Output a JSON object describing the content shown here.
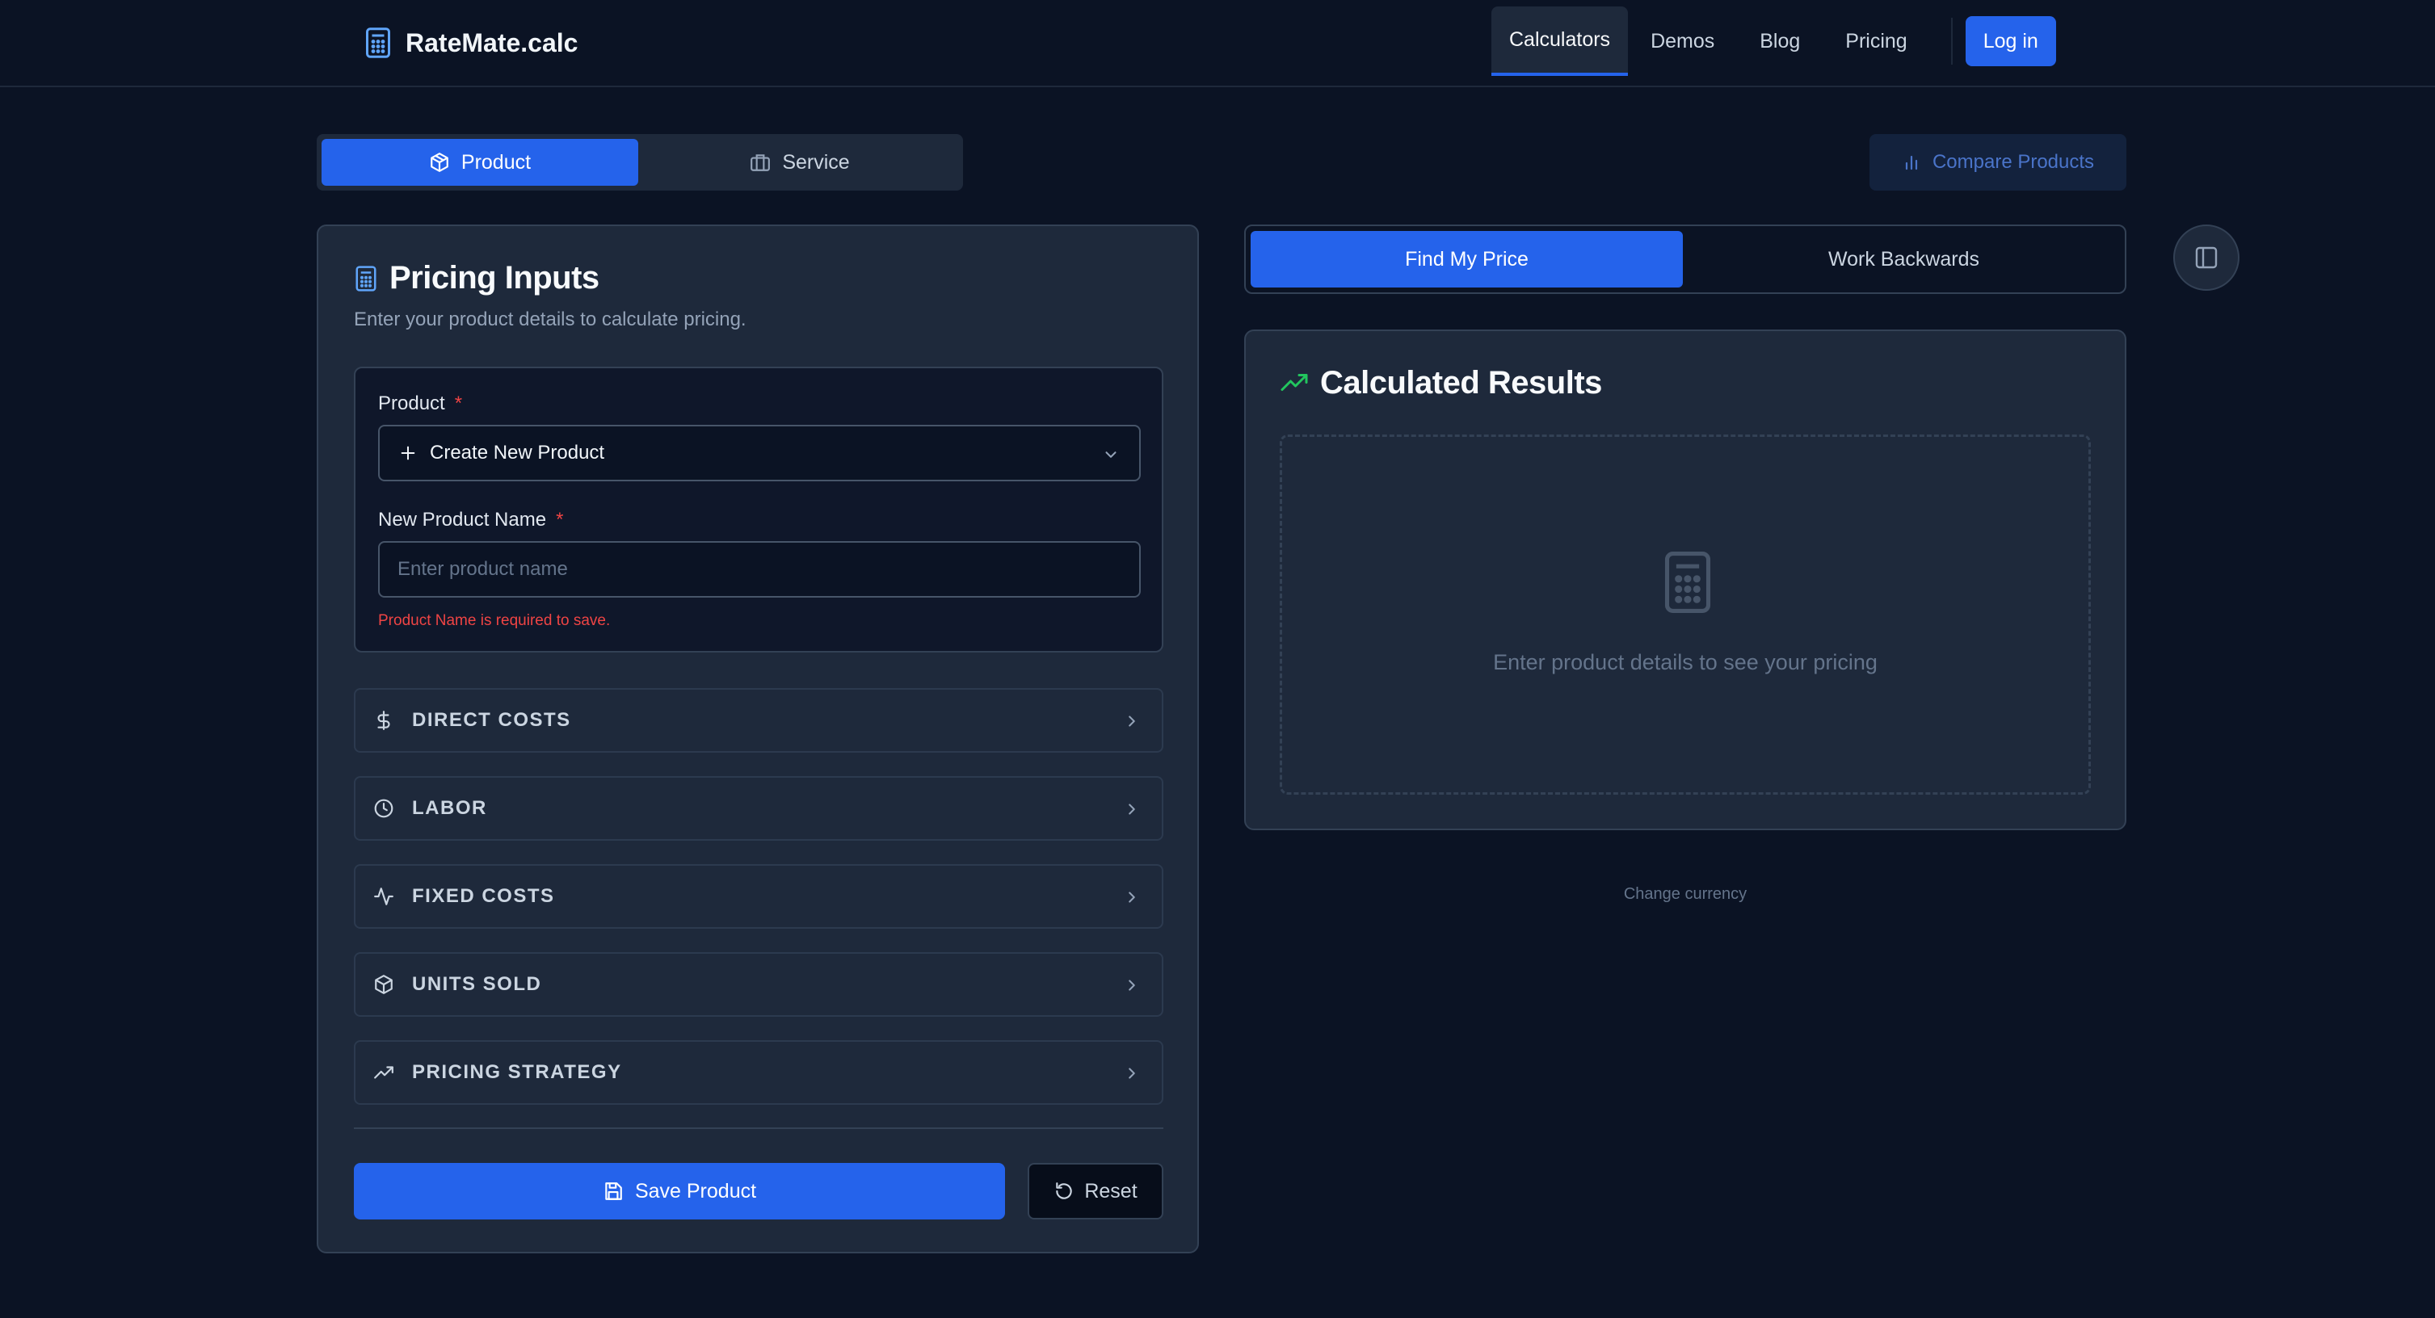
{
  "brand": {
    "name": "RateMate.calc",
    "icon": "calculator-icon"
  },
  "nav": {
    "items": [
      {
        "label": "Calculators",
        "active": true
      },
      {
        "label": "Demos",
        "active": false
      },
      {
        "label": "Blog",
        "active": false
      },
      {
        "label": "Pricing",
        "active": false
      }
    ],
    "login_label": "Log in"
  },
  "type_toggle": {
    "product_label": "Product",
    "service_label": "Service",
    "selected": "Product"
  },
  "compare_label": "Compare Products",
  "inputs": {
    "title": "Pricing Inputs",
    "subtitle": "Enter your product details to calculate pricing.",
    "product_field": {
      "label": "Product",
      "required_mark": "*",
      "selected_option": "Create New Product"
    },
    "name_field": {
      "label": "New Product Name",
      "required_mark": "*",
      "placeholder": "Enter product name",
      "value": "",
      "error": "Product Name is required to save."
    },
    "sections": [
      {
        "label": "DIRECT COSTS",
        "icon": "dollar-icon"
      },
      {
        "label": "LABOR",
        "icon": "clock-icon"
      },
      {
        "label": "FIXED COSTS",
        "icon": "activity-icon"
      },
      {
        "label": "UNITS SOLD",
        "icon": "box-icon"
      },
      {
        "label": "PRICING STRATEGY",
        "icon": "trending-up-icon"
      }
    ],
    "save_label": "Save Product",
    "reset_label": "Reset"
  },
  "mode_toggle": {
    "find_label": "Find My Price",
    "backwards_label": "Work Backwards",
    "selected": "Find My Price"
  },
  "results": {
    "title": "Calculated Results",
    "empty_text": "Enter product details to see your pricing"
  },
  "currency_link": "Change currency",
  "colors": {
    "background": "#0b1324",
    "card": "#1e293b",
    "accent": "#2563eb",
    "error": "#ef4444",
    "success": "#22c55e"
  }
}
